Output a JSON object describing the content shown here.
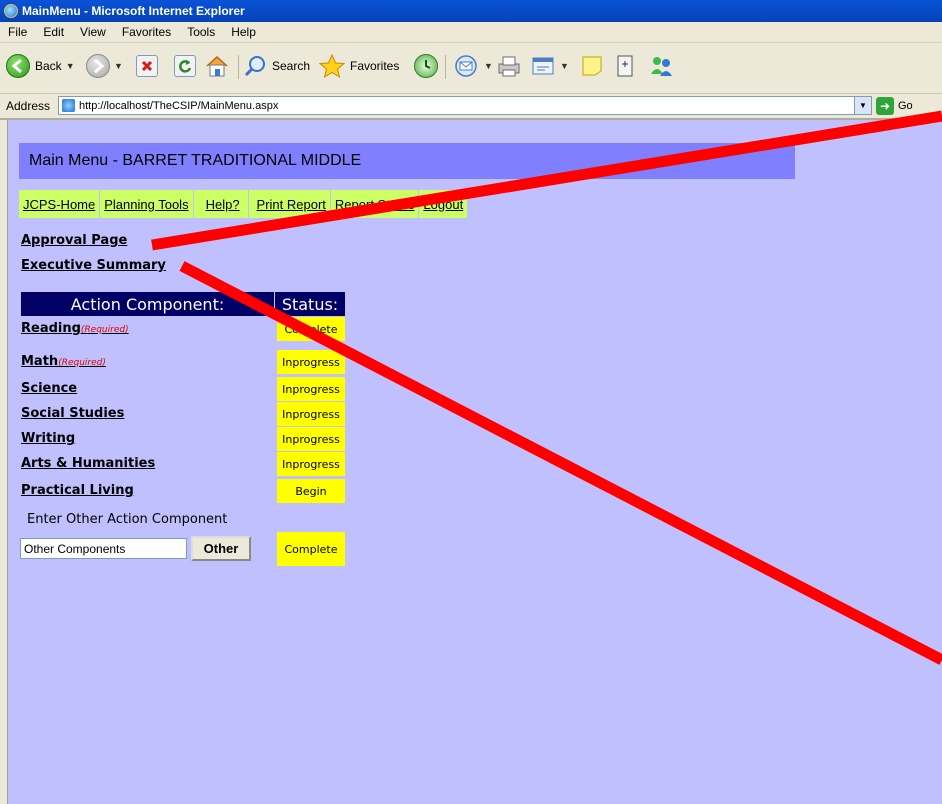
{
  "window": {
    "title": "MainMenu - Microsoft Internet Explorer"
  },
  "menubar": {
    "items": [
      "File",
      "Edit",
      "View",
      "Favorites",
      "Tools",
      "Help"
    ]
  },
  "toolbar": {
    "back_label": "Back",
    "search_label": "Search",
    "favorites_label": "Favorites"
  },
  "address": {
    "label": "Address",
    "url": "http://localhost/TheCSIP/MainMenu.aspx",
    "go_label": "Go"
  },
  "page": {
    "header": "Main Menu - BARRET TRADITIONAL MIDDLE",
    "nav": [
      "JCPS-Home",
      "Planning Tools",
      "Help?",
      "Print Report",
      "Report Status",
      "Logout"
    ],
    "links": {
      "approval": "Approval Page",
      "executive": "Executive Summary"
    },
    "table": {
      "col_component": "Action Component:",
      "col_status": "Status:",
      "rows": [
        {
          "name": "Reading",
          "note": "(Required)",
          "status": "Complete"
        },
        {
          "name": "Math",
          "note": "(Required)",
          "status": "Inprogress"
        },
        {
          "name": "Science",
          "note": "",
          "status": "Inprogress"
        },
        {
          "name": "Social Studies",
          "note": "",
          "status": "Inprogress"
        },
        {
          "name": "Writing",
          "note": "",
          "status": "Inprogress"
        },
        {
          "name": "Arts & Humanities",
          "note": "",
          "status": "Inprogress"
        },
        {
          "name": "Practical Living",
          "note": "",
          "status": "Begin"
        }
      ]
    },
    "other": {
      "label": "Enter Other Action Component",
      "input_value": "Other Components",
      "button_label": "Other",
      "status": "Complete"
    }
  },
  "colors": {
    "page_bg": "#c0c0ff",
    "header_bg": "#8080ff",
    "nav_bg": "#ccff66",
    "table_head_bg": "#000066",
    "status_bg": "#ffff00",
    "annotation": "#ff0000"
  }
}
